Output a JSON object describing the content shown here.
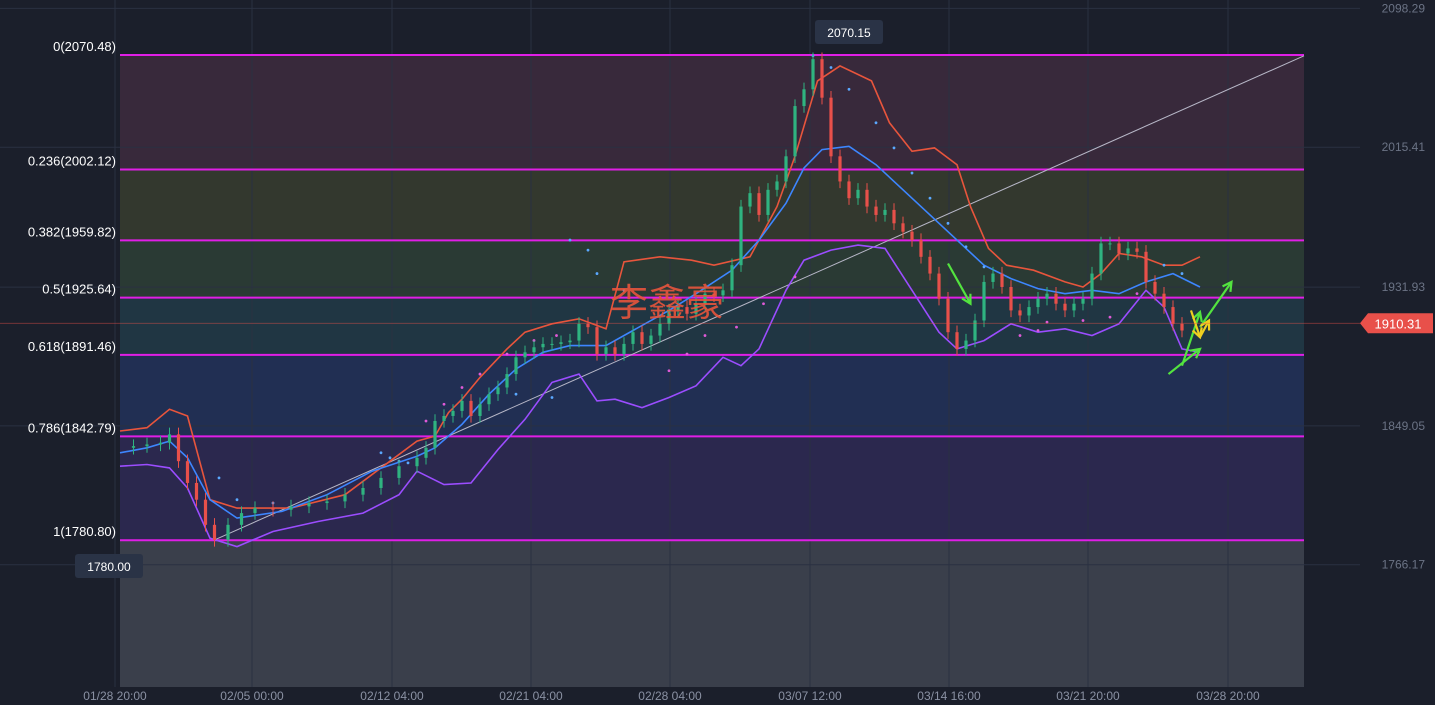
{
  "colors": {
    "background": "#1b1f2b",
    "grid": "#2a3142",
    "fib_line": "#e01ee6",
    "bull": "#2fb380",
    "bear": "#e8504a",
    "bb_upper": "#e8553c",
    "bb_middle": "#3d86ff",
    "bb_lower": "#9b4dff",
    "sar": "#5aa8ff",
    "sar_pink": "#e05ad8",
    "trend": "#b8b8c8",
    "arrow_green": "#53e33f",
    "arrow_yellow": "#f0d020",
    "watermark": "#e8553c"
  },
  "watermark_text": "李鑫豪",
  "chart_data": {
    "type": "candlestick",
    "title": "",
    "y_ticks": [
      "2098.29",
      "2015.41",
      "1931.93",
      "1849.05",
      "1766.17"
    ],
    "x_ticks": [
      "01/28 20:00",
      "02/05 00:00",
      "02/12 04:00",
      "02/21 04:00",
      "02/28 04:00",
      "03/07 12:00",
      "03/14 16:00",
      "03/21 20:00",
      "03/28 20:00"
    ],
    "ylim": [
      1736,
      2103
    ],
    "current_price": "1910.31",
    "high_label": "2070.15",
    "low_label": "1780.00",
    "fib_levels": [
      {
        "ratio": 0,
        "price": 2070.48,
        "label": "0(2070.48)"
      },
      {
        "ratio": 0.236,
        "price": 2002.12,
        "label": "0.236(2002.12)"
      },
      {
        "ratio": 0.382,
        "price": 1959.82,
        "label": "0.382(1959.82)"
      },
      {
        "ratio": 0.5,
        "price": 1925.64,
        "label": "0.5(1925.64)"
      },
      {
        "ratio": 0.618,
        "price": 1891.46,
        "label": "0.618(1891.46)"
      },
      {
        "ratio": 0.786,
        "price": 1842.79,
        "label": "0.786(1842.79)"
      },
      {
        "ratio": 1,
        "price": 1780.8,
        "label": "1(1780.80)"
      }
    ],
    "fib_zone_colors": [
      "#3a2a3c",
      "#353a2e",
      "#2b3c35",
      "#213845",
      "#223055",
      "#2c2950",
      "#33344c"
    ],
    "fib_bottom_color": "#3a3f4b",
    "bb_upper": [
      [
        0,
        1846
      ],
      [
        6,
        1848
      ],
      [
        11,
        1859
      ],
      [
        15,
        1855
      ],
      [
        20,
        1805
      ],
      [
        26,
        1800
      ],
      [
        38,
        1800
      ],
      [
        50,
        1808
      ],
      [
        60,
        1828
      ],
      [
        66,
        1840
      ],
      [
        70,
        1843
      ],
      [
        73,
        1857
      ],
      [
        76,
        1865
      ],
      [
        80,
        1878
      ],
      [
        86,
        1895
      ],
      [
        90,
        1905
      ],
      [
        96,
        1910
      ],
      [
        102,
        1913
      ],
      [
        108,
        1907
      ],
      [
        112,
        1947
      ],
      [
        120,
        1950
      ],
      [
        127,
        1948
      ],
      [
        132,
        1945
      ],
      [
        140,
        1950
      ],
      [
        146,
        1980
      ],
      [
        150,
        2010
      ],
      [
        155,
        2055
      ],
      [
        160,
        2064
      ],
      [
        167,
        2055
      ],
      [
        171,
        2030
      ],
      [
        176,
        2013
      ],
      [
        181,
        2015
      ],
      [
        186,
        2005
      ],
      [
        189,
        1980
      ],
      [
        193,
        1955
      ],
      [
        197,
        1945
      ],
      [
        203,
        1942
      ],
      [
        210,
        1935
      ],
      [
        214,
        1932
      ],
      [
        218,
        1940
      ],
      [
        222,
        1952
      ],
      [
        227,
        1950
      ],
      [
        232,
        1945
      ],
      [
        236,
        1945
      ],
      [
        240,
        1950
      ]
    ],
    "bb_middle": [
      [
        0,
        1833
      ],
      [
        6,
        1836
      ],
      [
        11,
        1840
      ],
      [
        15,
        1830
      ],
      [
        20,
        1805
      ],
      [
        26,
        1794
      ],
      [
        36,
        1798
      ],
      [
        46,
        1808
      ],
      [
        56,
        1822
      ],
      [
        66,
        1831
      ],
      [
        70,
        1836
      ],
      [
        76,
        1850
      ],
      [
        82,
        1868
      ],
      [
        88,
        1883
      ],
      [
        94,
        1893
      ],
      [
        100,
        1897
      ],
      [
        108,
        1897
      ],
      [
        114,
        1906
      ],
      [
        122,
        1918
      ],
      [
        128,
        1928
      ],
      [
        136,
        1942
      ],
      [
        142,
        1960
      ],
      [
        148,
        1982
      ],
      [
        152,
        2003
      ],
      [
        156,
        2014
      ],
      [
        162,
        2016
      ],
      [
        168,
        2005
      ],
      [
        174,
        1990
      ],
      [
        180,
        1975
      ],
      [
        186,
        1960
      ],
      [
        192,
        1945
      ],
      [
        198,
        1937
      ],
      [
        204,
        1931
      ],
      [
        210,
        1928
      ],
      [
        216,
        1930
      ],
      [
        222,
        1928
      ],
      [
        228,
        1935
      ],
      [
        234,
        1940
      ],
      [
        240,
        1932
      ]
    ],
    "bb_lower": [
      [
        0,
        1825
      ],
      [
        6,
        1826
      ],
      [
        11,
        1824
      ],
      [
        15,
        1812
      ],
      [
        20,
        1782
      ],
      [
        26,
        1777
      ],
      [
        34,
        1786
      ],
      [
        44,
        1792
      ],
      [
        54,
        1797
      ],
      [
        62,
        1808
      ],
      [
        66,
        1822
      ],
      [
        72,
        1814
      ],
      [
        78,
        1815
      ],
      [
        84,
        1835
      ],
      [
        90,
        1853
      ],
      [
        96,
        1875
      ],
      [
        102,
        1880
      ],
      [
        106,
        1864
      ],
      [
        110,
        1865
      ],
      [
        116,
        1860
      ],
      [
        122,
        1866
      ],
      [
        128,
        1873
      ],
      [
        134,
        1890
      ],
      [
        138,
        1885
      ],
      [
        142,
        1895
      ],
      [
        148,
        1930
      ],
      [
        152,
        1948
      ],
      [
        158,
        1954
      ],
      [
        164,
        1957
      ],
      [
        170,
        1955
      ],
      [
        176,
        1930
      ],
      [
        182,
        1905
      ],
      [
        186,
        1895
      ],
      [
        192,
        1900
      ],
      [
        198,
        1910
      ],
      [
        204,
        1905
      ],
      [
        210,
        1907
      ],
      [
        216,
        1903
      ],
      [
        222,
        1910
      ],
      [
        228,
        1930
      ],
      [
        232,
        1920
      ],
      [
        236,
        1895
      ],
      [
        240,
        1893
      ]
    ],
    "sar_pink": [
      [
        68,
        1852
      ],
      [
        72,
        1862
      ],
      [
        76,
        1872
      ],
      [
        80,
        1880
      ],
      [
        86,
        1892
      ],
      [
        92,
        1900
      ],
      [
        97,
        1903
      ],
      [
        122,
        1882
      ],
      [
        126,
        1892
      ],
      [
        130,
        1903
      ],
      [
        137,
        1908
      ],
      [
        143,
        1922
      ],
      [
        150,
        1938
      ],
      [
        200,
        1903
      ],
      [
        204,
        1906
      ],
      [
        206,
        1911
      ],
      [
        214,
        1912
      ],
      [
        220,
        1914
      ],
      [
        226,
        1928
      ],
      [
        230,
        1934
      ]
    ],
    "sar_blue": [
      [
        22,
        1818
      ],
      [
        26,
        1805
      ],
      [
        34,
        1803
      ],
      [
        58,
        1833
      ],
      [
        60,
        1830
      ],
      [
        62,
        1828
      ],
      [
        64,
        1827
      ],
      [
        84,
        1870
      ],
      [
        88,
        1868
      ],
      [
        96,
        1866
      ],
      [
        100,
        1960
      ],
      [
        104,
        1954
      ],
      [
        106,
        1940
      ],
      [
        112,
        1930
      ],
      [
        154,
        2070
      ],
      [
        158,
        2063
      ],
      [
        162,
        2050
      ],
      [
        168,
        2030
      ],
      [
        172,
        2015
      ],
      [
        176,
        2000
      ],
      [
        180,
        1985
      ],
      [
        184,
        1970
      ],
      [
        188,
        1956
      ],
      [
        192,
        1944
      ],
      [
        196,
        1935
      ],
      [
        228,
        1950
      ],
      [
        232,
        1945
      ],
      [
        236,
        1940
      ]
    ],
    "candles": [
      [
        0,
        1836
      ],
      [
        3,
        1837
      ],
      [
        6,
        1838
      ],
      [
        9,
        1839
      ],
      [
        11,
        1844
      ],
      [
        13,
        1828
      ],
      [
        15,
        1815
      ],
      [
        17,
        1805
      ],
      [
        19,
        1790
      ],
      [
        21,
        1781
      ],
      [
        24,
        1790
      ],
      [
        27,
        1797
      ],
      [
        30,
        1800
      ],
      [
        34,
        1799
      ],
      [
        38,
        1801
      ],
      [
        42,
        1803
      ],
      [
        46,
        1804
      ],
      [
        50,
        1808
      ],
      [
        54,
        1812
      ],
      [
        58,
        1818
      ],
      [
        62,
        1825
      ],
      [
        66,
        1830
      ],
      [
        68,
        1836
      ],
      [
        70,
        1852
      ],
      [
        72,
        1855
      ],
      [
        74,
        1858
      ],
      [
        76,
        1864
      ],
      [
        78,
        1855
      ],
      [
        80,
        1862
      ],
      [
        82,
        1868
      ],
      [
        84,
        1872
      ],
      [
        86,
        1880
      ],
      [
        88,
        1890
      ],
      [
        90,
        1893
      ],
      [
        92,
        1896
      ],
      [
        94,
        1898
      ],
      [
        96,
        1898
      ],
      [
        98,
        1899
      ],
      [
        100,
        1900
      ],
      [
        102,
        1910
      ],
      [
        104,
        1908
      ],
      [
        106,
        1892
      ],
      [
        108,
        1896
      ],
      [
        110,
        1892
      ],
      [
        112,
        1898
      ],
      [
        114,
        1905
      ],
      [
        116,
        1898
      ],
      [
        118,
        1903
      ],
      [
        120,
        1910
      ],
      [
        122,
        1918
      ],
      [
        124,
        1920
      ],
      [
        126,
        1916
      ],
      [
        128,
        1922
      ],
      [
        130,
        1928
      ],
      [
        132,
        1927
      ],
      [
        134,
        1930
      ],
      [
        136,
        1945
      ],
      [
        138,
        1980
      ],
      [
        140,
        1988
      ],
      [
        142,
        1975
      ],
      [
        144,
        1990
      ],
      [
        146,
        1995
      ],
      [
        148,
        2010
      ],
      [
        150,
        2040
      ],
      [
        152,
        2050
      ],
      [
        154,
        2068
      ],
      [
        156,
        2045
      ],
      [
        158,
        2010
      ],
      [
        160,
        1995
      ],
      [
        162,
        1985
      ],
      [
        164,
        1990
      ],
      [
        166,
        1980
      ],
      [
        168,
        1975
      ],
      [
        170,
        1978
      ],
      [
        172,
        1970
      ],
      [
        174,
        1965
      ],
      [
        176,
        1960
      ],
      [
        178,
        1950
      ],
      [
        180,
        1940
      ],
      [
        182,
        1925
      ],
      [
        184,
        1905
      ],
      [
        186,
        1895
      ],
      [
        188,
        1900
      ],
      [
        190,
        1912
      ],
      [
        192,
        1935
      ],
      [
        194,
        1940
      ],
      [
        196,
        1932
      ],
      [
        198,
        1918
      ],
      [
        200,
        1915
      ],
      [
        202,
        1920
      ],
      [
        204,
        1925
      ],
      [
        206,
        1928
      ],
      [
        208,
        1922
      ],
      [
        210,
        1918
      ],
      [
        212,
        1922
      ],
      [
        214,
        1925
      ],
      [
        216,
        1940
      ],
      [
        218,
        1958
      ],
      [
        220,
        1958
      ],
      [
        222,
        1952
      ],
      [
        224,
        1955
      ],
      [
        226,
        1953
      ],
      [
        228,
        1935
      ],
      [
        230,
        1928
      ],
      [
        232,
        1920
      ],
      [
        234,
        1910
      ],
      [
        236,
        1906
      ]
    ],
    "trend_line": [
      [
        21,
        1781
      ],
      [
        240,
        2070
      ]
    ],
    "arrows": [
      {
        "color": "green",
        "from": [
          184,
          1946
        ],
        "to": [
          189,
          1922
        ]
      },
      {
        "color": "green",
        "from": [
          233,
          1880
        ],
        "to": [
          240,
          1895
        ]
      },
      {
        "color": "green",
        "from": [
          236,
          1885
        ],
        "to": [
          240,
          1917
        ]
      },
      {
        "color": "green",
        "from": [
          240,
          1908
        ],
        "to": [
          247,
          1935
        ]
      },
      {
        "color": "yellow",
        "from": [
          238,
          1918
        ],
        "to": [
          240,
          1902
        ]
      },
      {
        "color": "yellow",
        "from": [
          240,
          1902
        ],
        "to": [
          242,
          1912
        ]
      }
    ]
  }
}
